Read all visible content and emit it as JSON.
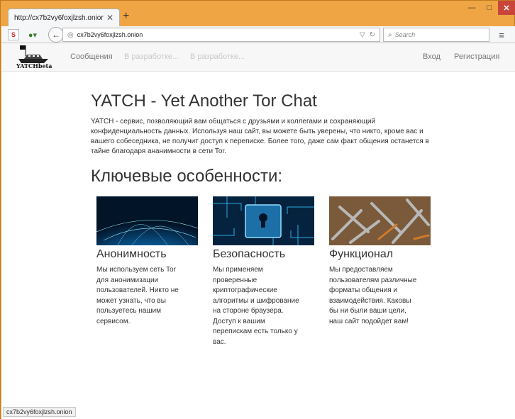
{
  "browser": {
    "tab_title": "http://cx7b2vy6foxjlzsh.onion/",
    "url": "cx7b2vy6foxjlzsh.onion",
    "search_placeholder": "Search",
    "status_url": "cx7b2vy6foxjlzsh.onion"
  },
  "site": {
    "logo_text": "YATCHbeta",
    "nav": {
      "messages": "Сообщения",
      "dev1": "В разработке...",
      "dev2": "В разработке...",
      "login": "Вход",
      "register": "Регистрация"
    },
    "title": "YATCH - Yet Another Tor Chat",
    "lead": "YATCH - сервис, позволяющий вам общаться с друзьями и коллегами и сохраняющий конфиденциальность данных. Используя наш сайт, вы можете быть уверены, что никто, кроме вас и вашего собеседника, не получит доступ к переписке. Более того, даже сам факт общения останется в тайне благодаря ананимности в сети Tor.",
    "features_heading": "Ключевые особенности:",
    "features": [
      {
        "title": "Анонимность",
        "text": "Мы используем сеть Tor для анонимизации пользователей. Никто не может узнать, что вы пользуетесь нашим сервисом."
      },
      {
        "title": "Безопасность",
        "text": "Мы применяем проверенные криптографические алгоритмы и шифрование на стороне браузера. Доступ к вашим перепискам есть только у вас."
      },
      {
        "title": "Функционал",
        "text": "Мы предоставляем пользователям различные форматы общения и взаимодействия. Каковы бы ни были ваши цели, наш сайт подойдет вам!"
      }
    ]
  }
}
